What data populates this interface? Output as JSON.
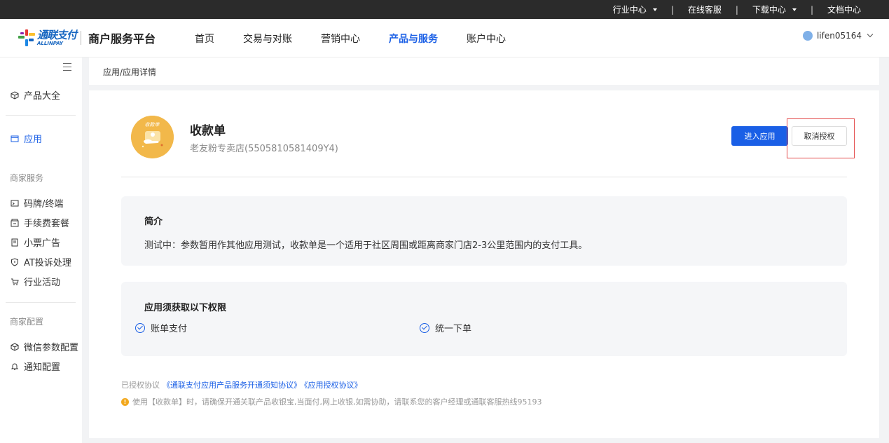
{
  "topbar": {
    "items": [
      {
        "label": "行业中心",
        "dropdown": true
      },
      {
        "label": "在线客服",
        "dropdown": false
      },
      {
        "label": "下载中心",
        "dropdown": true
      },
      {
        "label": "文档中心",
        "dropdown": false
      }
    ]
  },
  "header": {
    "logo_cn": "通联支付",
    "logo_en": "ALLINPAY",
    "platform_title": "商户服务平台",
    "nav": [
      {
        "label": "首页"
      },
      {
        "label": "交易与对账"
      },
      {
        "label": "营销中心"
      },
      {
        "label": "产品与服务",
        "active": true
      },
      {
        "label": "账户中心"
      }
    ],
    "username": "lifen05164"
  },
  "sidebar": {
    "items": [
      {
        "label": "产品大全",
        "icon": "box-icon"
      },
      {
        "label": "应用",
        "icon": "app-window-icon",
        "active": true
      }
    ],
    "section_merchant_service": "商家服务",
    "merchant_service_items": [
      {
        "label": "码牌/终端",
        "icon": "terminal-icon"
      },
      {
        "label": "手续费套餐",
        "icon": "fee-package-icon"
      },
      {
        "label": "小票广告",
        "icon": "receipt-icon"
      },
      {
        "label": "AT投诉处理",
        "icon": "shield-icon"
      },
      {
        "label": "行业活动",
        "icon": "cart-icon"
      }
    ],
    "section_merchant_config": "商家配置",
    "merchant_config_items": [
      {
        "label": "微信参数配置",
        "icon": "cube-icon"
      },
      {
        "label": "通知配置",
        "icon": "bell-icon"
      }
    ]
  },
  "breadcrumb": "应用/应用详情",
  "app": {
    "name": "收款单",
    "logo_text": "收款单",
    "store": "老友粉专卖店(5505810581409Y4)",
    "enter_button": "进入应用",
    "revoke_button": "取消授权"
  },
  "intro": {
    "title": "简介",
    "text": "测试中：参数暂用作其他应用测试，收款单是一个适用于社区周围或距离商家门店2-3公里范围内的支付工具。"
  },
  "permissions": {
    "title": "应用须获取以下权限",
    "items": [
      "账单支付",
      "统一下单"
    ]
  },
  "agreements": {
    "prefix": "已授权协议",
    "links": [
      "《通联支付应用产品服务开通须知协议》",
      "《应用授权协议》"
    ]
  },
  "notice": "使用【收款单】时，请确保开通关联产品收银宝,当面付,网上收银,如需协助，请联系您的客户经理或通联客服热线95193",
  "colors": {
    "accent": "#1a5fe6",
    "topbar": "#2b2b2b",
    "app_logo_bg": "#f2b84a",
    "highlight": "#e34b4b",
    "warning": "#f2a81d"
  }
}
